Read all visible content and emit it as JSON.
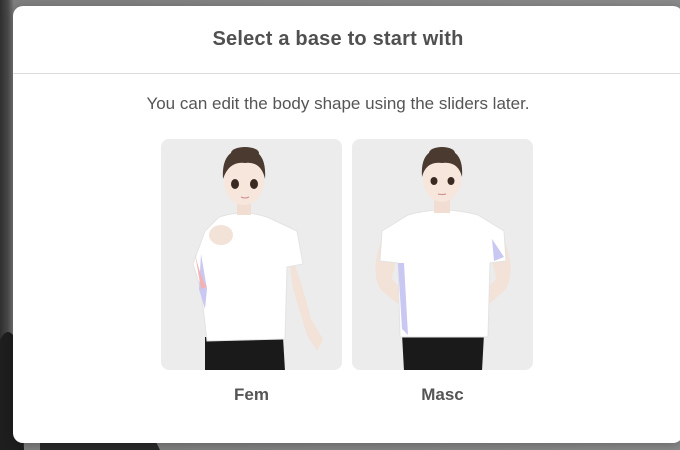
{
  "dialog": {
    "title": "Select a base to start with",
    "subtitle": "You can edit the body shape using the sliders later."
  },
  "options": [
    {
      "label": "Fem",
      "preview": "fem-avatar-illustration"
    },
    {
      "label": "Masc",
      "preview": "masc-avatar-illustration"
    }
  ],
  "colors": {
    "card_background": "#ececec",
    "title_text": "#505050",
    "body_text": "#555555",
    "shirt": "#ffffff",
    "shorts": "#1a1a1a",
    "hair": "#4a3a30",
    "skin": "#f6e6dc"
  }
}
